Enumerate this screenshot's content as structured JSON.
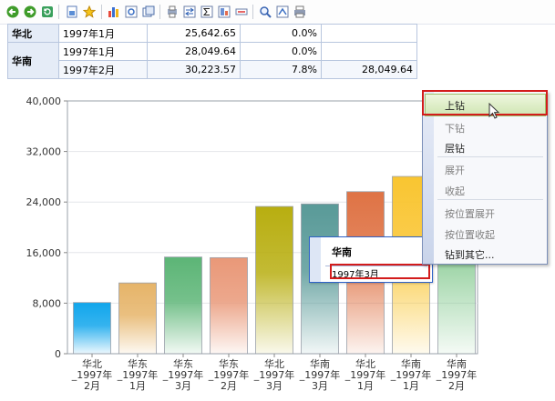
{
  "toolbar": {
    "buttons": [
      "back-icon",
      "forward-icon",
      "refresh-icon",
      "export-icon",
      "favorite-icon",
      "chart-icon",
      "zoom-chart-icon",
      "window-icon",
      "print-preview-icon",
      "swap-icon",
      "sum-icon",
      "pivot-icon",
      "filter-icon",
      "search-icon",
      "export-excel-icon",
      "print-icon"
    ]
  },
  "table": {
    "rows": [
      {
        "region": "华北",
        "date": "1997年1月",
        "value": "25,642.65",
        "pct": "0.0%",
        "prev": ""
      },
      {
        "region": "华南",
        "date": "1997年1月",
        "value": "28,049.64",
        "pct": "0.0%",
        "prev": ""
      },
      {
        "region": "",
        "date": "1997年2月",
        "value": "30,223.57",
        "pct": "7.8%",
        "prev": "28,049.64"
      }
    ]
  },
  "chart_data": {
    "type": "bar",
    "categories": [
      [
        "华北",
        "_1997年",
        "2月"
      ],
      [
        "华东",
        "_1997年",
        "1月"
      ],
      [
        "华东",
        "_1997年",
        "3月"
      ],
      [
        "华东",
        "_1997年",
        "2月"
      ],
      [
        "华北",
        "_1997年",
        "3月"
      ],
      [
        "华南",
        "_1997年",
        "3月"
      ],
      [
        "华北",
        "_1997年",
        "1月"
      ],
      [
        "华南",
        "_1997年",
        "1月"
      ],
      [
        "华南",
        "_1997年",
        "2月"
      ]
    ],
    "values": [
      8100,
      11200,
      15300,
      15200,
      23300,
      23700,
      25642.65,
      28049.64,
      30223.57
    ],
    "colors": [
      "#11a6ec",
      "#e6b469",
      "#5cb576",
      "#e99878",
      "#b8ae10",
      "#599a98",
      "#df7345",
      "#f9c531",
      "#7cc688"
    ],
    "yticks": [
      "0",
      "8,000",
      "16,000",
      "24,000",
      "32,000",
      "40,000"
    ],
    "ylim": [
      0,
      40000
    ],
    "grid": true
  },
  "menu": {
    "items": [
      {
        "label": "上钻",
        "enabled": true,
        "highlighted": true
      },
      {
        "label": "下钻",
        "enabled": false
      },
      {
        "label": "层钻",
        "enabled": true
      },
      {
        "label": "展开",
        "enabled": false
      },
      {
        "label": "收起",
        "enabled": false
      },
      {
        "label": "按位置展开",
        "enabled": false
      },
      {
        "label": "按位置收起",
        "enabled": false
      },
      {
        "label": "钻到其它...",
        "enabled": true
      }
    ]
  },
  "tooltip": {
    "title": "华南",
    "value": "1997年3月"
  }
}
